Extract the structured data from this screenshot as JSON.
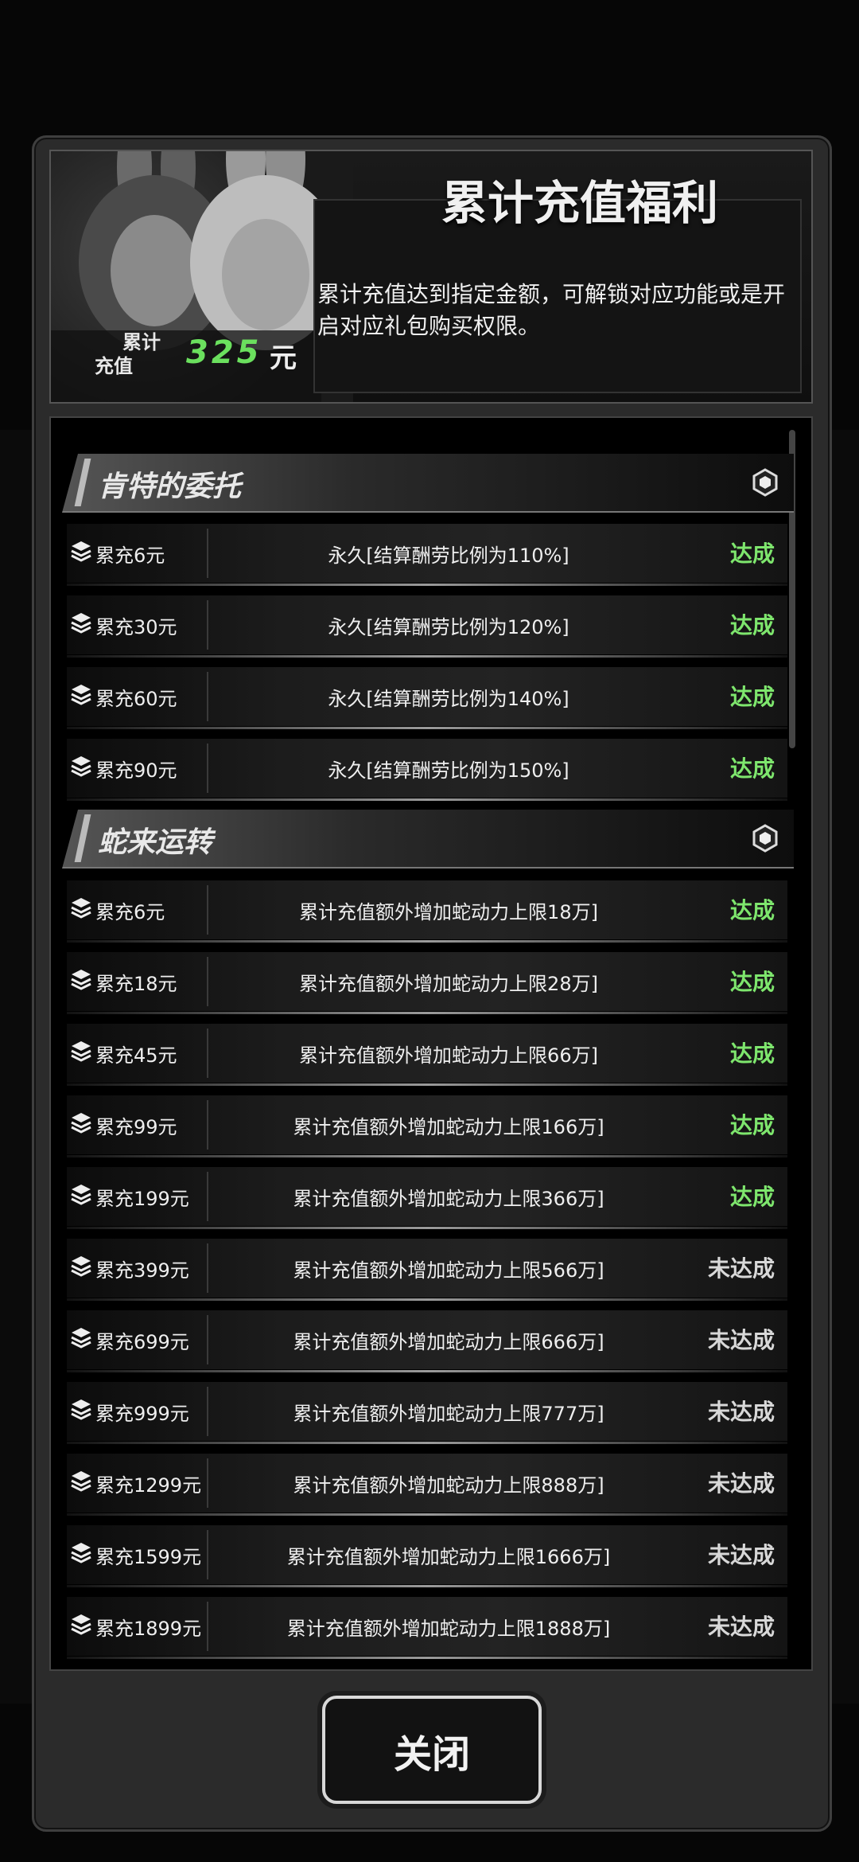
{
  "header": {
    "title": "累计充值福利",
    "description": "累计充值达到指定金额，可解锁对应功能或是开启对应礼包购买权限。",
    "total_label_1": "累计",
    "total_label_2": "充值",
    "total_amount": "325",
    "total_unit": "元"
  },
  "sections": [
    {
      "title": "肯特的委托",
      "rows": [
        {
          "amount": "累充6元",
          "reward": "永久[结算酬劳比例为110%]",
          "status": "达成"
        },
        {
          "amount": "累充30元",
          "reward": "永久[结算酬劳比例为120%]",
          "status": "达成"
        },
        {
          "amount": "累充60元",
          "reward": "永久[结算酬劳比例为140%]",
          "status": "达成"
        },
        {
          "amount": "累充90元",
          "reward": "永久[结算酬劳比例为150%]",
          "status": "达成"
        }
      ]
    },
    {
      "title": "蛇来运转",
      "rows": [
        {
          "amount": "累充6元",
          "reward": "累计充值额外增加蛇动力上限18万]",
          "status": "达成"
        },
        {
          "amount": "累充18元",
          "reward": "累计充值额外增加蛇动力上限28万]",
          "status": "达成"
        },
        {
          "amount": "累充45元",
          "reward": "累计充值额外增加蛇动力上限66万]",
          "status": "达成"
        },
        {
          "amount": "累充99元",
          "reward": "累计充值额外增加蛇动力上限166万]",
          "status": "达成"
        },
        {
          "amount": "累充199元",
          "reward": "累计充值额外增加蛇动力上限366万]",
          "status": "达成"
        },
        {
          "amount": "累充399元",
          "reward": "累计充值额外增加蛇动力上限566万]",
          "status": "未达成"
        },
        {
          "amount": "累充699元",
          "reward": "累计充值额外增加蛇动力上限666万]",
          "status": "未达成"
        },
        {
          "amount": "累充999元",
          "reward": "累计充值额外增加蛇动力上限777万]",
          "status": "未达成"
        },
        {
          "amount": "累充1299元",
          "reward": "累计充值额外增加蛇动力上限888万]",
          "status": "未达成"
        },
        {
          "amount": "累充1599元",
          "reward": "累计充值额外增加蛇动力上限1666万]",
          "status": "未达成"
        },
        {
          "amount": "累充1899元",
          "reward": "累计充值额外增加蛇动力上限1888万]",
          "status": "未达成"
        }
      ]
    }
  ],
  "close_button": "关闭",
  "colors": {
    "achieved": "#7ee66d",
    "not_achieved": "#d8d8d8",
    "amount": "#6be05e"
  }
}
